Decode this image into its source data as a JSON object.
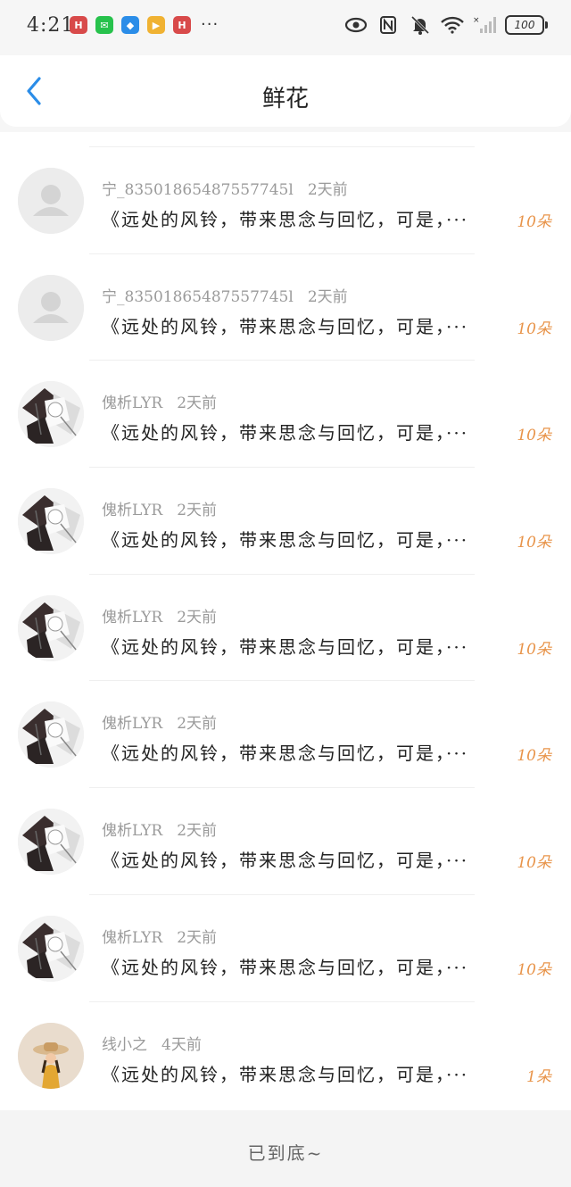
{
  "status_bar": {
    "time": "4:21",
    "app_icons": [
      {
        "name": "huawei-app-icon",
        "color": "#d84a4a",
        "glyph": "H"
      },
      {
        "name": "wechat-icon",
        "color": "#27c24c",
        "glyph": "✉"
      },
      {
        "name": "blue-app-icon",
        "color": "#2b8de8",
        "glyph": "◆"
      },
      {
        "name": "video-app-icon",
        "color": "#f0b232",
        "glyph": "▶"
      },
      {
        "name": "huawei-app-icon-2",
        "color": "#d84a4a",
        "glyph": "H"
      }
    ],
    "more": "···",
    "battery": "100"
  },
  "header": {
    "title": "鲜花",
    "accent": "#2b8de8"
  },
  "items": [
    {
      "avatar": "placeholder",
      "name": "宁_83501865487557745l",
      "time": "2天前",
      "message": "《远处的风铃，带来思念与回忆，可是，···",
      "count": "10朵"
    },
    {
      "avatar": "placeholder",
      "name": "宁_83501865487557745l",
      "time": "2天前",
      "message": "《远处的风铃，带来思念与回忆，可是，···",
      "count": "10朵"
    },
    {
      "avatar": "anime",
      "name": "傀析LYR",
      "time": "2天前",
      "message": "《远处的风铃，带来思念与回忆，可是，···",
      "count": "10朵"
    },
    {
      "avatar": "anime",
      "name": "傀析LYR",
      "time": "2天前",
      "message": "《远处的风铃，带来思念与回忆，可是，···",
      "count": "10朵"
    },
    {
      "avatar": "anime",
      "name": "傀析LYR",
      "time": "2天前",
      "message": "《远处的风铃，带来思念与回忆，可是，···",
      "count": "10朵"
    },
    {
      "avatar": "anime",
      "name": "傀析LYR",
      "time": "2天前",
      "message": "《远处的风铃，带来思念与回忆，可是，···",
      "count": "10朵"
    },
    {
      "avatar": "anime",
      "name": "傀析LYR",
      "time": "2天前",
      "message": "《远处的风铃，带来思念与回忆，可是，···",
      "count": "10朵"
    },
    {
      "avatar": "anime",
      "name": "傀析LYR",
      "time": "2天前",
      "message": "《远处的风铃，带来思念与回忆，可是，···",
      "count": "10朵"
    },
    {
      "avatar": "photo",
      "name": "线小之",
      "time": "4天前",
      "message": "《远处的风铃，带来思念与回忆，可是，···",
      "count": "1朵"
    }
  ],
  "footer": {
    "text": "已到底~"
  },
  "colors": {
    "count": "#e8944a",
    "meta": "#9a9a9a"
  }
}
